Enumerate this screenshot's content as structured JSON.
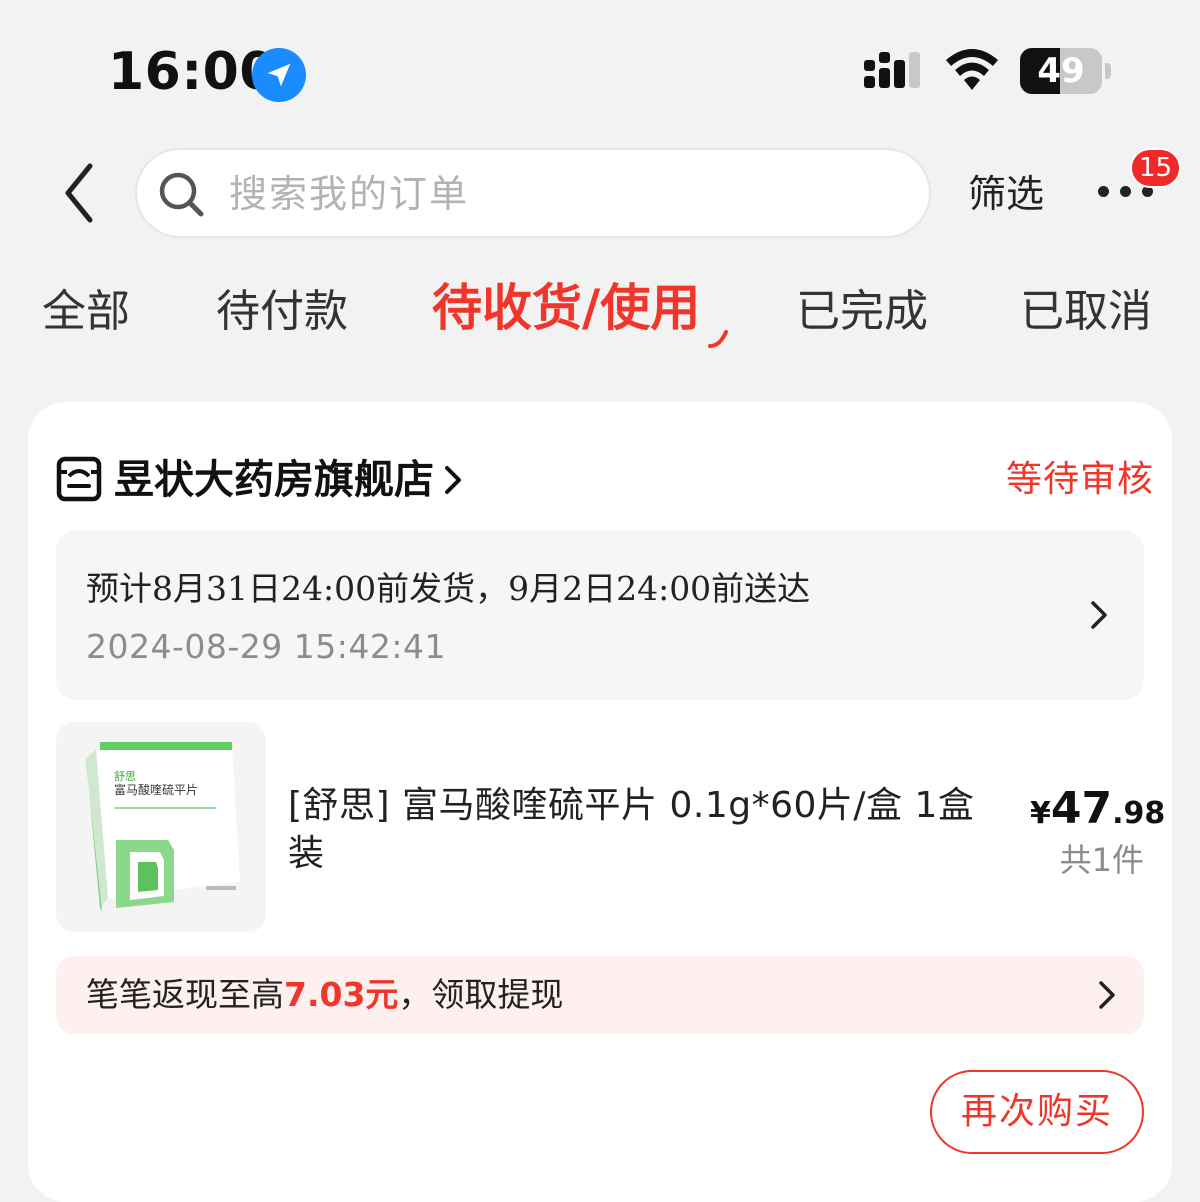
{
  "status_bar": {
    "time": "16:00",
    "battery_level": "49",
    "battery_fraction": 0.49,
    "icons": [
      "location-arrow-icon",
      "cellular-signal-icon",
      "wifi-icon",
      "battery-icon"
    ]
  },
  "header": {
    "back_icon": "chevron-left-icon",
    "search_placeholder": "搜索我的订单",
    "filter_label": "筛选",
    "more_icon": "more-dots-icon",
    "notification_count": "15"
  },
  "tabs": [
    {
      "label": "全部",
      "active": false
    },
    {
      "label": "待付款",
      "active": false
    },
    {
      "label": "待收货/使用",
      "active": true
    },
    {
      "label": "已完成",
      "active": false
    },
    {
      "label": "已取消",
      "active": false
    }
  ],
  "order": {
    "shop_icon": "store-icon",
    "shop_name": "昱状大药房旗舰店",
    "status": "等待审核",
    "delivery_estimate": "预计8月31日24:00前发货，9月2日24:00前送达",
    "order_time": "2024-08-29 15:42:41",
    "product": {
      "title": "[舒思] 富马酸喹硫平片 0.1g*60片/盒 1盒装",
      "box_label": "富马酸喹硫平片",
      "price_symbol": "¥",
      "price_int": "47",
      "price_dec": ".98",
      "quantity": "共1件"
    },
    "cashback": {
      "prefix": "笔笔返现至高",
      "amount": "7.03元",
      "suffix": "，领取提现"
    },
    "rebuy_label": "再次购买"
  },
  "colors": {
    "accent": "#f0362b",
    "background": "#f2f2f2",
    "card": "#ffffff",
    "location_blue": "#1a8cff"
  }
}
